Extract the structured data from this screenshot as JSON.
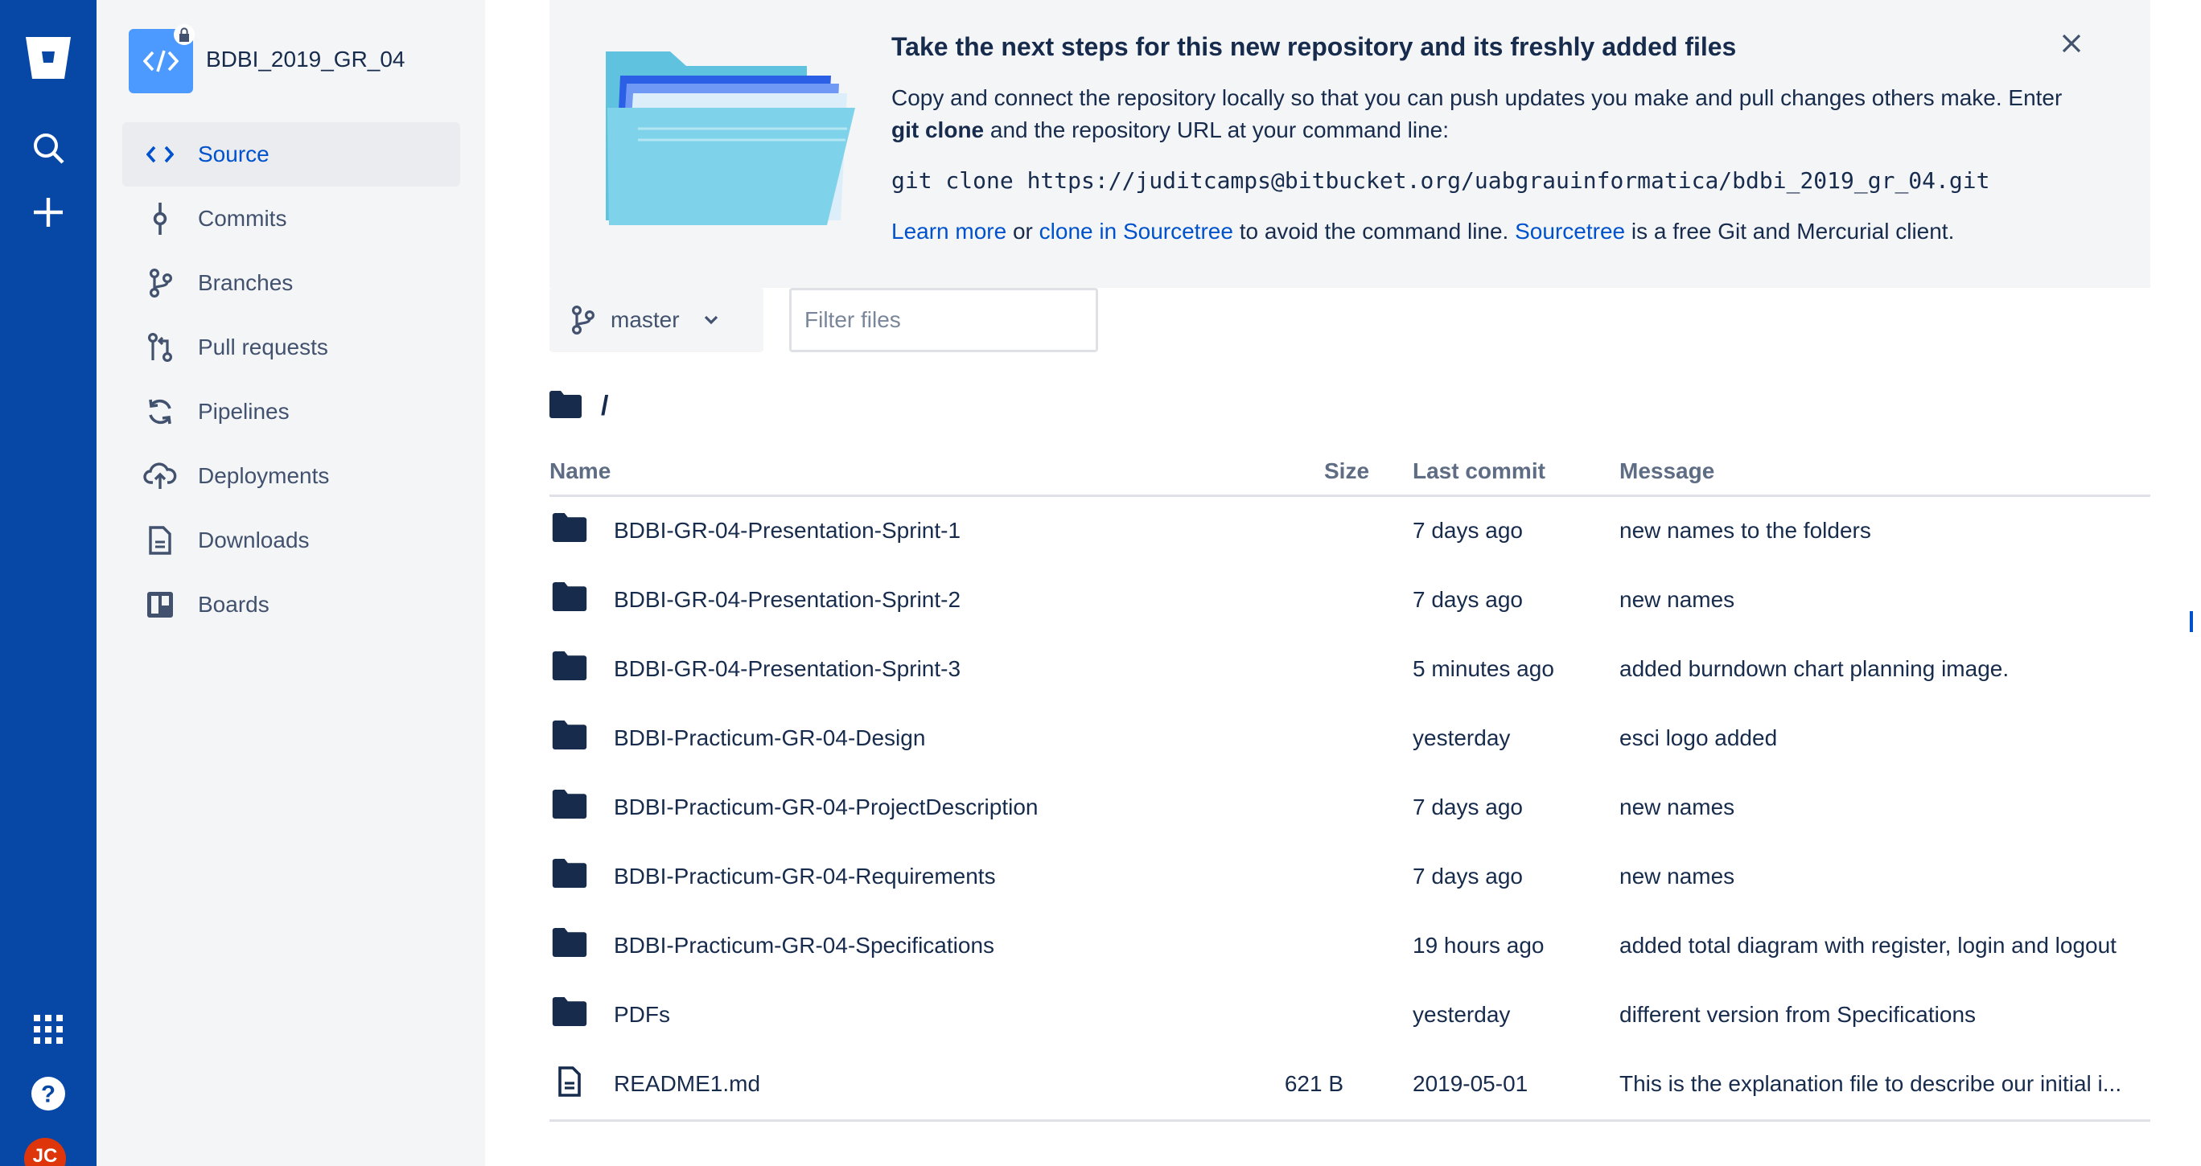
{
  "global_nav": {
    "logo": "bitbucket-logo",
    "search_icon": "search-icon",
    "create_icon": "plus-icon",
    "apps_icon": "app-switcher-icon",
    "help_icon": "help-icon",
    "avatar_initials": "JC",
    "brand_color": "#0747a6",
    "avatar_color": "#de350b"
  },
  "repo": {
    "name": "BDBI_2019_GR_04",
    "icon": "code-icon",
    "private_icon": "lock-icon"
  },
  "sidebar": {
    "items": [
      {
        "label": "Source",
        "icon": "code-icon",
        "active": true
      },
      {
        "label": "Commits",
        "icon": "commit-icon"
      },
      {
        "label": "Branches",
        "icon": "branch-icon"
      },
      {
        "label": "Pull requests",
        "icon": "pull-request-icon"
      },
      {
        "label": "Pipelines",
        "icon": "pipelines-icon"
      },
      {
        "label": "Deployments",
        "icon": "cloud-upload-icon"
      },
      {
        "label": "Downloads",
        "icon": "file-icon"
      },
      {
        "label": "Boards",
        "icon": "board-icon"
      }
    ]
  },
  "banner": {
    "title": "Take the next steps for this new repository and its freshly added files",
    "text_1": "Copy and connect the repository locally so that you can push updates you make and pull changes others make. Enter ",
    "text_bold": "git clone",
    "text_2": " and the repository URL at your command line:",
    "command": "git clone https://juditcamps@bitbucket.org/uabgrauinformatica/bdbi_2019_gr_04.git",
    "link_learn_more": "Learn more",
    "or_text": " or ",
    "link_clone": "clone in Sourcetree",
    "mid_text": " to avoid the command line. ",
    "link_sourcetree": "Sourcetree",
    "end_text": " is a free Git and Mercurial client.",
    "close_icon": "close-icon"
  },
  "toolbar": {
    "branch": "master",
    "filter_placeholder": "Filter files"
  },
  "breadcrumb": {
    "path": "/"
  },
  "table": {
    "headers": {
      "name": "Name",
      "size": "Size",
      "last_commit": "Last commit",
      "message": "Message"
    },
    "rows": [
      {
        "type": "folder",
        "name": "BDBI-GR-04-Presentation-Sprint-1",
        "size": "",
        "last_commit": "7 days ago",
        "message": "new names to the folders"
      },
      {
        "type": "folder",
        "name": "BDBI-GR-04-Presentation-Sprint-2",
        "size": "",
        "last_commit": "7 days ago",
        "message": "new names"
      },
      {
        "type": "folder",
        "name": "BDBI-GR-04-Presentation-Sprint-3",
        "size": "",
        "last_commit": "5 minutes ago",
        "message": "added burndown chart planning image."
      },
      {
        "type": "folder",
        "name": "BDBI-Practicum-GR-04-Design",
        "size": "",
        "last_commit": "yesterday",
        "message": "esci logo added"
      },
      {
        "type": "folder",
        "name": "BDBI-Practicum-GR-04-ProjectDescription",
        "size": "",
        "last_commit": "7 days ago",
        "message": "new names"
      },
      {
        "type": "folder",
        "name": "BDBI-Practicum-GR-04-Requirements",
        "size": "",
        "last_commit": "7 days ago",
        "message": "new names"
      },
      {
        "type": "folder",
        "name": "BDBI-Practicum-GR-04-Specifications",
        "size": "",
        "last_commit": "19 hours ago",
        "message": "added total diagram with register, login and logout"
      },
      {
        "type": "folder",
        "name": "PDFs",
        "size": "",
        "last_commit": "yesterday",
        "message": "different version from Specifications"
      },
      {
        "type": "file",
        "name": "README1.md",
        "size": "621 B",
        "last_commit": "2019-05-01",
        "message": "This is the explanation file to describe our initial i..."
      }
    ]
  }
}
